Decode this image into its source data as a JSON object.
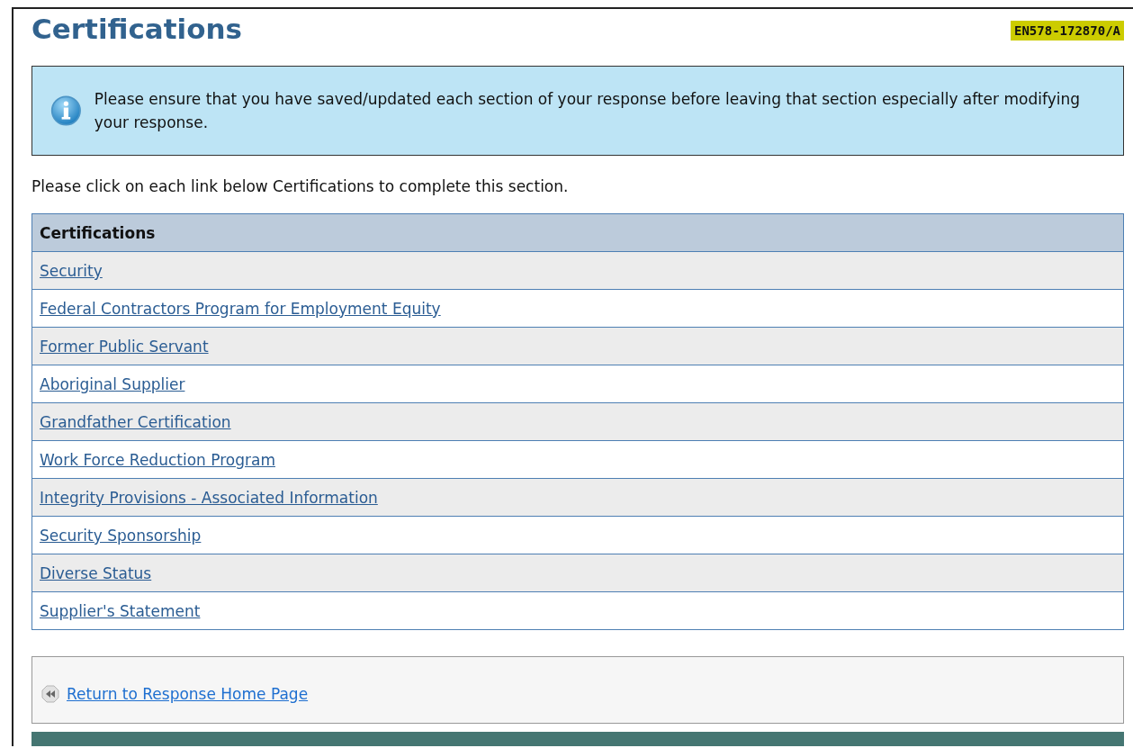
{
  "page": {
    "title": "Certifications",
    "reference": "EN578-172870/A"
  },
  "notice": {
    "text": "Please ensure that you have saved/updated each section of your response before leaving that section especially after modifying your response."
  },
  "instruction": "Please click on each link below Certifications to complete this section.",
  "table": {
    "columns": [
      "Certifications"
    ],
    "rows": [
      {
        "label": "Security"
      },
      {
        "label": "Federal Contractors Program for Employment Equity"
      },
      {
        "label": "Former Public Servant"
      },
      {
        "label": "Aboriginal Supplier"
      },
      {
        "label": "Grandfather Certification"
      },
      {
        "label": "Work Force Reduction Program"
      },
      {
        "label": "Integrity Provisions - Associated Information"
      },
      {
        "label": "Security Sponsorship"
      },
      {
        "label": "Diverse Status"
      },
      {
        "label": "Supplier's Statement"
      }
    ]
  },
  "footer": {
    "link": "Return to Response Home Page"
  }
}
